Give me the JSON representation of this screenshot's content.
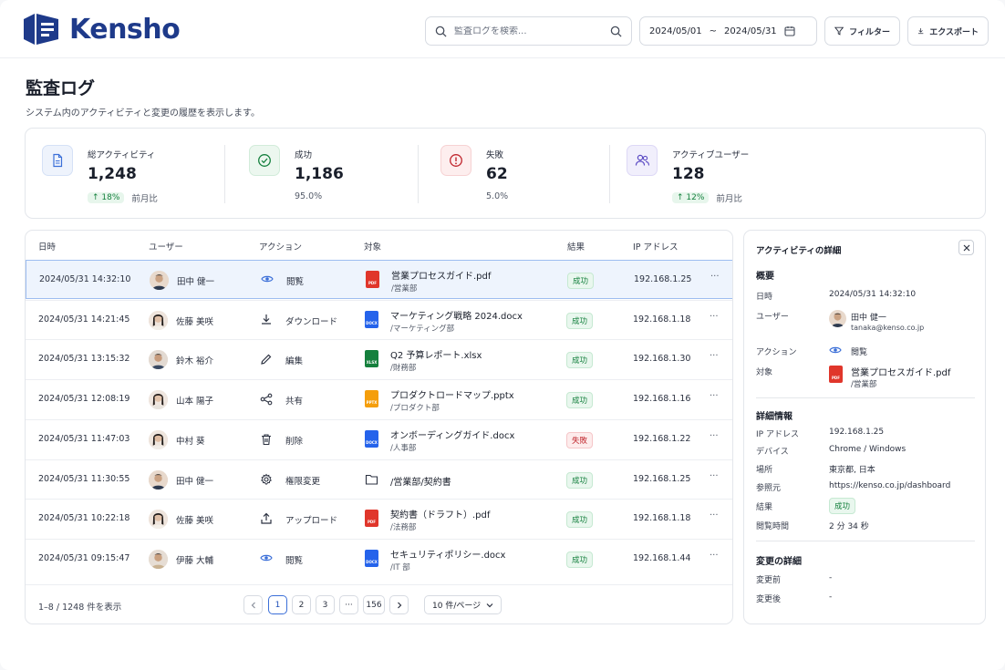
{
  "brand": {
    "name": "Kensho"
  },
  "search": {
    "placeholder": "監査ログを検索..."
  },
  "date_range": {
    "start": "2024/05/01",
    "separator": "~",
    "end": "2024/05/31"
  },
  "toolbar": {
    "filter_label": "フィルター",
    "export_label": "エクスポート"
  },
  "page": {
    "title": "監査ログ",
    "subtitle": "システム内のアクティビティと変更の履歴を表示します。"
  },
  "stats": [
    {
      "label": "総アクティビティ",
      "value": "1,248",
      "trend": "↑ 18%",
      "note": "前月比"
    },
    {
      "label": "成功",
      "value": "1,186",
      "note": "95.0%"
    },
    {
      "label": "失敗",
      "value": "62",
      "note": "5.0%"
    },
    {
      "label": "アクティブユーザー",
      "value": "128",
      "trend": "↑ 12%",
      "note": "前月比"
    }
  ],
  "table": {
    "columns": [
      "日時",
      "ユーザー",
      "アクション",
      "対象",
      "結果",
      "IP アドレス"
    ],
    "rows": [
      {
        "datetime": "2024/05/31 14:32:10",
        "user": "田中 健一",
        "action": "閲覧",
        "action_icon": "eye-icon",
        "file_type": "PDF",
        "file": "営業プロセスガイド.pdf",
        "path": "/営業部",
        "result": "成功",
        "ip": "192.168.1.25",
        "more": "···"
      },
      {
        "datetime": "2024/05/31 14:21:45",
        "user": "佐藤 美咲",
        "action": "ダウンロード",
        "action_icon": "download-icon",
        "file_type": "DOCX",
        "file": "マーケティング戦略 2024.docx",
        "path": "/マーケティング部",
        "result": "成功",
        "ip": "192.168.1.18",
        "more": "···"
      },
      {
        "datetime": "2024/05/31 13:15:32",
        "user": "鈴木 裕介",
        "action": "編集",
        "action_icon": "pencil-icon",
        "file_type": "XLSX",
        "file": "Q2 予算レポート.xlsx",
        "path": "/財務部",
        "result": "成功",
        "ip": "192.168.1.30",
        "more": "···"
      },
      {
        "datetime": "2024/05/31 12:08:19",
        "user": "山本 陽子",
        "action": "共有",
        "action_icon": "share-icon",
        "file_type": "PPTX",
        "file": "プロダクトロードマップ.pptx",
        "path": "/プロダクト部",
        "result": "成功",
        "ip": "192.168.1.16",
        "more": "···"
      },
      {
        "datetime": "2024/05/31 11:47:03",
        "user": "中村 葵",
        "action": "削除",
        "action_icon": "trash-icon",
        "file_type": "DOCX",
        "file": "オンボーディングガイド.docx",
        "path": "/人事部",
        "result": "失敗",
        "ip": "192.168.1.22",
        "more": "···"
      },
      {
        "datetime": "2024/05/31 11:30:55",
        "user": "田中 健一",
        "action": "権限変更",
        "action_icon": "gear-icon",
        "file_type": "FOLDER",
        "file": "/営業部/契約書",
        "path": "",
        "result": "成功",
        "ip": "192.168.1.25",
        "more": "···"
      },
      {
        "datetime": "2024/05/31 10:22:18",
        "user": "佐藤 美咲",
        "action": "アップロード",
        "action_icon": "upload-icon",
        "file_type": "PDF",
        "file": "契約書（ドラフト）.pdf",
        "path": "/法務部",
        "result": "成功",
        "ip": "192.168.1.18",
        "more": "···"
      },
      {
        "datetime": "2024/05/31 09:15:47",
        "user": "伊藤 大輔",
        "action": "閲覧",
        "action_icon": "eye-icon",
        "file_type": "DOCX",
        "file": "セキュリティポリシー.docx",
        "path": "/IT 部",
        "result": "成功",
        "ip": "192.168.1.44",
        "more": "···"
      }
    ]
  },
  "pagination": {
    "info": "1–8 / 1248 件を表示",
    "pages": [
      "1",
      "2",
      "3",
      "···",
      "156"
    ],
    "current": "1",
    "per_page": "10 件/ページ"
  },
  "detail": {
    "title": "アクティビティの詳細",
    "overview_heading": "概要",
    "date_label": "日時",
    "date": "2024/05/31 14:32:10",
    "user_label": "ユーザー",
    "user_name": "田中 健一",
    "user_email": "tanaka@kenso.co.jp",
    "action_label": "アクション",
    "action": "閲覧",
    "target_label": "対象",
    "target_file": "営業プロセスガイド.pdf",
    "target_path": "/営業部",
    "target_type": "PDF",
    "info_heading": "詳細情報",
    "ip_label": "IP アドレス",
    "ip": "192.168.1.25",
    "device_label": "デバイス",
    "device": "Chrome / Windows",
    "location_label": "場所",
    "location": "東京都, 日本",
    "referrer_label": "参照元",
    "referrer": "https://kenso.co.jp/dashboard",
    "result_label": "結果",
    "result": "成功",
    "duration_label": "閲覧時間",
    "duration": "2 分 34 秒",
    "changes_heading": "変更の詳細",
    "before_label": "変更前",
    "before": "-",
    "after_label": "変更後",
    "after": "-"
  },
  "colors": {
    "brand": "#1e3a8a",
    "success": "#16813f",
    "danger": "#c0262d",
    "pdf": "#e0362b",
    "docx": "#2563eb",
    "xlsx": "#15803d",
    "pptx": "#f59e0b"
  }
}
